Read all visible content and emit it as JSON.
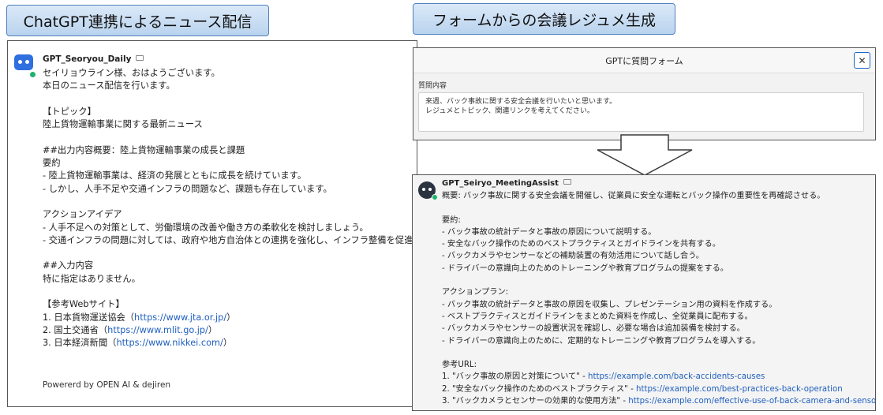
{
  "callouts": {
    "left": "ChatGPT連携によるニュース配信",
    "right": "フォームからの会議レジュメ生成"
  },
  "left_chat": {
    "bot_name": "GPT_Seoryou_Daily",
    "lines": [
      "セイリョウライン様、おはようございます。",
      "本日のニュース配信を行います。",
      "",
      "【トピック】",
      "陸上貨物運輸事業に関する最新ニュース",
      "",
      "##出力内容概要：陸上貨物運輸事業の成長と課題",
      "要約",
      "- 陸上貨物運輸事業は、経済の発展とともに成長を続けています。",
      "- しかし、人手不足や交通インフラの問題など、課題も存在しています。",
      "",
      "アクションアイデア",
      "- 人手不足への対策として、労働環境の改善や働き方の柔軟化を検討しましょう。",
      "- 交通インフラの問題に対しては、政府や地方自治体との連携を強化し、インフラ整備を促進",
      "",
      "##入力内容",
      "特に指定はありません。",
      "",
      "【参考Webサイト】"
    ],
    "references": [
      {
        "text": "1. 日本貨物運送協会（",
        "url": "https://www.jta.or.jp/",
        "close": "）"
      },
      {
        "text": "2. 国土交通省（",
        "url": "https://www.mlit.go.jp/",
        "close": "）"
      },
      {
        "text": "3. 日本経済新聞（",
        "url": "https://www.nikkei.com/",
        "close": "）"
      }
    ],
    "powered": "Powererd by OPEN AI & dejiren"
  },
  "form": {
    "title": "GPTに質問フォーム",
    "close_symbol": "✕",
    "field_label": "質問内容",
    "question": "来週、バック事故に関する安全会議を行いたいと思います。\nレジュメとトピック、関連リンクを考えてください。"
  },
  "right_chat": {
    "bot_name": "GPT_Seiryo_MeetingAssist",
    "lines": [
      "概要: バック事故に関する安全会議を開催し、従業員に安全な運転とバック操作の重要性を再確認させる。",
      "",
      "要約:",
      "- バック事故の統計データと事故の原因について説明する。",
      "- 安全なバック操作のためのベストプラクティスとガイドラインを共有する。",
      "- バックカメラやセンサーなどの補助装置の有効活用について話し合う。",
      "- ドライバーの意識向上のためのトレーニングや教育プログラムの提案をする。",
      "",
      "アクションプラン:",
      "- バック事故の統計データと事故の原因を収集し、プレゼンテーション用の資料を作成する。",
      "- ベストプラクティスとガイドラインをまとめた資料を作成し、全従業員に配布する。",
      "- バックカメラやセンサーの設置状況を確認し、必要な場合は追加装備を検討する。",
      "- ドライバーの意識向上のために、定期的なトレーニングや教育プログラムを導入する。",
      "",
      "参考URL:"
    ],
    "references": [
      {
        "text": "1. \"バック事故の原因と対策について\" - ",
        "url": "https://example.com/back-accidents-causes"
      },
      {
        "text": "2. \"安全なバック操作のためのベストプラクティス\" - ",
        "url": "https://example.com/best-practices-back-operation"
      },
      {
        "text": "3. \"バックカメラとセンサーの効果的な使用方法\" - ",
        "url": "https://example.com/effective-use-of-back-camera-and-sensors"
      }
    ]
  },
  "colors": {
    "accent": "#1e67c8",
    "link": "#1f5fbf",
    "online": "#20b26b",
    "callout_border": "#4f81bd"
  }
}
